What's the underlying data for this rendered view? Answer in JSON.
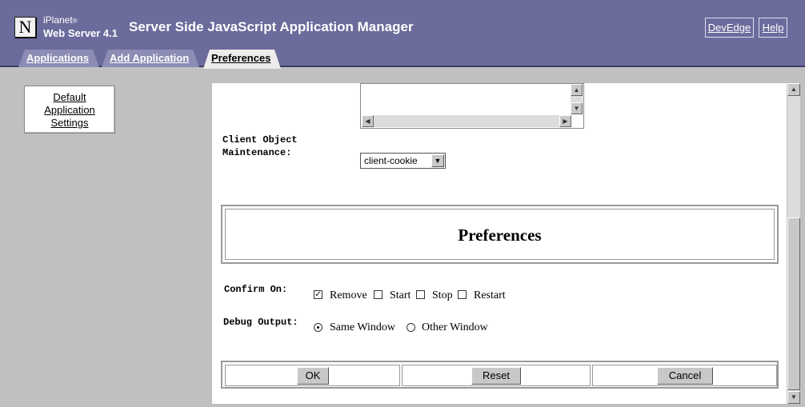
{
  "header": {
    "brand_line1": "iPlanet",
    "brand_line2": "Web Server 4.1",
    "title": "Server Side JavaScript Application Manager",
    "devedge_label": "DevEdge",
    "help_label": "Help"
  },
  "tabs": [
    {
      "label": "Applications"
    },
    {
      "label": "Add Application"
    },
    {
      "label": "Preferences",
      "active": true
    }
  ],
  "sidebar": {
    "items": [
      {
        "label_line1": "Default",
        "label_line2": "Application",
        "label_line3": "Settings"
      }
    ]
  },
  "form": {
    "client_object_label_line1": "Client Object",
    "client_object_label_line2": "Maintenance:",
    "client_object_value": "client-cookie",
    "section_title": "Preferences",
    "confirm_label": "Confirm On:",
    "confirm_options": [
      {
        "label": "Remove",
        "checked": true
      },
      {
        "label": "Start",
        "checked": false
      },
      {
        "label": "Stop",
        "checked": false
      },
      {
        "label": "Restart",
        "checked": false
      }
    ],
    "debug_label": "Debug Output:",
    "debug_options": [
      {
        "label": "Same Window",
        "selected": true
      },
      {
        "label": "Other Window",
        "selected": false
      }
    ]
  },
  "buttons": {
    "ok": "OK",
    "reset": "Reset",
    "cancel": "Cancel"
  },
  "colors": {
    "header_bg": "#6b6b9c",
    "tab_bg": "#8c8cb5",
    "page_bg": "#c0c0c0"
  }
}
